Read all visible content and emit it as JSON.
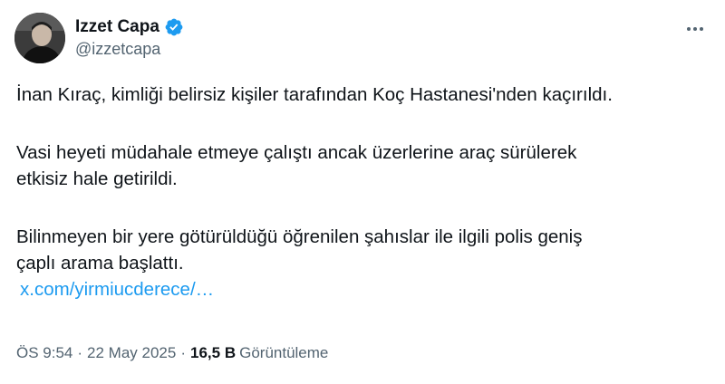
{
  "author": {
    "display_name": "Izzet Capa",
    "handle": "@izzetcapa",
    "verified_icon": "verified-badge-icon",
    "avatar_icon": "profile-avatar"
  },
  "menu": {
    "more_icon": "more-options-icon"
  },
  "tweet": {
    "paragraph_1": "İnan Kıraç, kimliği belirsiz kişiler tarafından Koç Hastanesi'nden kaçırıldı.",
    "paragraph_2_line_1": "Vasi heyeti müdahale etmeye çalıştı ancak üzerlerine araç sürülerek",
    "paragraph_2_line_2": "etkisiz hale getirildi.",
    "paragraph_3_line_1": "Bilinmeyen bir yere götürüldüğü öğrenilen şahıslar ile ilgili polis geniş",
    "paragraph_3_line_2": "çaplı arama başlattı.",
    "link_text": "x.com/yirmiucderece/…"
  },
  "meta": {
    "time": "ÖS 9:54",
    "separator_1": "·",
    "date": "22 May 2025",
    "separator_2": "·",
    "views_count": "16,5 B",
    "views_label": "Görüntüleme"
  },
  "colors": {
    "text_primary": "#0f1419",
    "text_secondary": "#536471",
    "link": "#1d9bf0",
    "verified_badge": "#1d9bf0"
  }
}
